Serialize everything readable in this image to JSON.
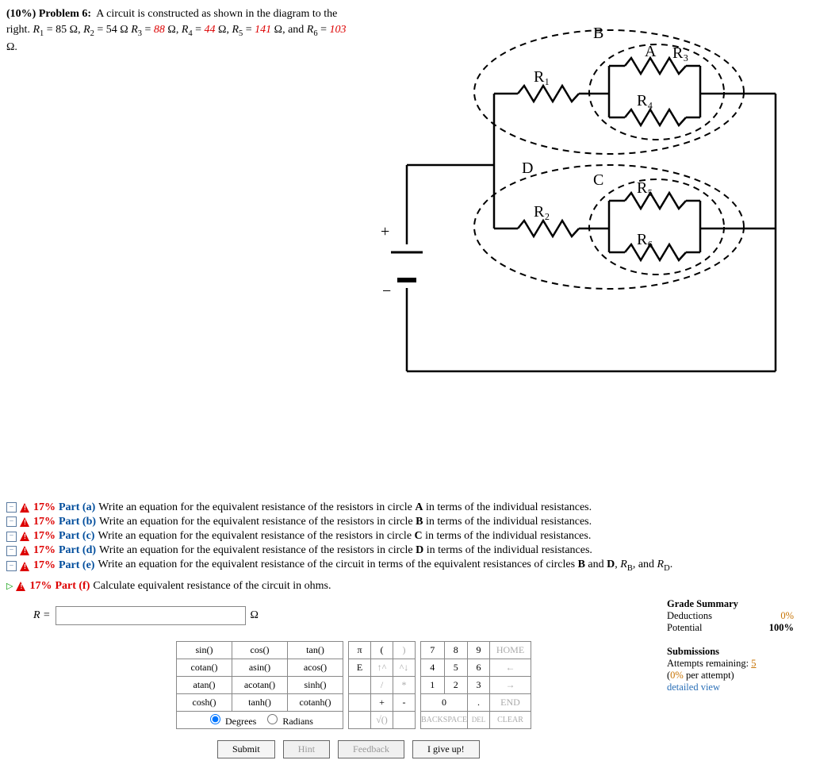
{
  "problem": {
    "weight_label": "(10%)",
    "title": "Problem 6:",
    "text_prefix": "A circuit is constructed as shown in the diagram to the right. ",
    "R1_label": "R",
    "R1_sub": "1",
    "R1_val": " = 85 Ω, ",
    "R2_label": "R",
    "R2_sub": "2",
    "R2_val": " = 54 Ω ",
    "R3_label": "R",
    "R3_sub": "3",
    "R3_val": " = ",
    "R3_num": "88",
    "R3_unit": " Ω, ",
    "R4_label": "R",
    "R4_sub": "4",
    "R4_val": " = ",
    "R4_num": "44",
    "R4_unit": " Ω, ",
    "R5_label": "R",
    "R5_sub": "5",
    "R5_val": " = ",
    "R5_num": "141",
    "R5_unit": " Ω, and ",
    "R6_label": "R",
    "R6_sub": "6",
    "R6_val": " = ",
    "R6_num": "103",
    "R6_unit": " Ω."
  },
  "diagram": {
    "B": "B",
    "A": "A",
    "C": "C",
    "D": "D",
    "R1": "R₁",
    "R2": "R₂",
    "R3": "R₃",
    "R4": "R₄",
    "R5": "R₅",
    "R6": "R₆",
    "plus": "+",
    "minus": "−"
  },
  "parts": {
    "a": {
      "pct": "17%",
      "label": "Part (a)",
      "text": "Write an equation for the equivalent resistance of the resistors in circle ",
      "bold": "A",
      "tail": " in terms of the individual resistances."
    },
    "b": {
      "pct": "17%",
      "label": "Part (b)",
      "text": "Write an equation for the equivalent resistance of the resistors in circle ",
      "bold": "B",
      "tail": " in terms of the individual resistances."
    },
    "c": {
      "pct": "17%",
      "label": "Part (c)",
      "text": "Write an equation for the equivalent resistance of the resistors in circle ",
      "bold": "C",
      "tail": " in terms of the individual resistances."
    },
    "d": {
      "pct": "17%",
      "label": "Part (d)",
      "text": "Write an equation for the equivalent resistance of the resistors in circle ",
      "bold": "D",
      "tail": " in terms of the individual resistances."
    },
    "e": {
      "pct": "17%",
      "label": "Part (e)",
      "text": "Write an equation for the equivalent resistance of the circuit in terms of the equivalent resistances of circles ",
      "bold1": "B",
      "mid": " and ",
      "bold2": "D",
      "tail2": ", ",
      "rb": "R",
      "rbs": "B",
      "tail3": ", and ",
      "rd": "R",
      "rds": "D",
      "tail4": "."
    },
    "f": {
      "pct": "17%",
      "label": "Part (f)",
      "text": "Calculate equivalent resistance of the circuit in ohms."
    }
  },
  "answer": {
    "prefix": "R = ",
    "unit": "Ω"
  },
  "keypad": {
    "fn": [
      [
        "sin()",
        "cos()",
        "tan()"
      ],
      [
        "cotan()",
        "asin()",
        "acos()"
      ],
      [
        "atan()",
        "acotan()",
        "sinh()"
      ],
      [
        "cosh()",
        "tanh()",
        "cotanh()"
      ]
    ],
    "sym": [
      [
        "π",
        "(",
        ")"
      ],
      [
        "E",
        "↑^",
        "^↓"
      ],
      [
        "",
        "/",
        "*"
      ],
      [
        "",
        "+",
        "-"
      ],
      [
        "",
        "√()",
        ""
      ]
    ],
    "num": [
      [
        "7",
        "8",
        "9",
        "HOME"
      ],
      [
        "4",
        "5",
        "6",
        "←"
      ],
      [
        "1",
        "2",
        "3",
        "→"
      ],
      [
        "0",
        "",
        ".",
        "END"
      ],
      [
        "BACKSPACE",
        "",
        "DEL",
        "CLEAR"
      ]
    ],
    "degrees": "Degrees",
    "radians": "Radians"
  },
  "ctrl": {
    "submit": "Submit",
    "hint": "Hint",
    "feedback": "Feedback",
    "giveup": "I give up!"
  },
  "grade": {
    "title": "Grade Summary",
    "ded_label": "Deductions",
    "ded_val": "0%",
    "pot_label": "Potential",
    "pot_val": "100%",
    "sub_title": "Submissions",
    "att_label": "Attempts remaining: ",
    "att_val": "5",
    "per_attempt": "(0% per attempt)",
    "detailed": "detailed view"
  }
}
